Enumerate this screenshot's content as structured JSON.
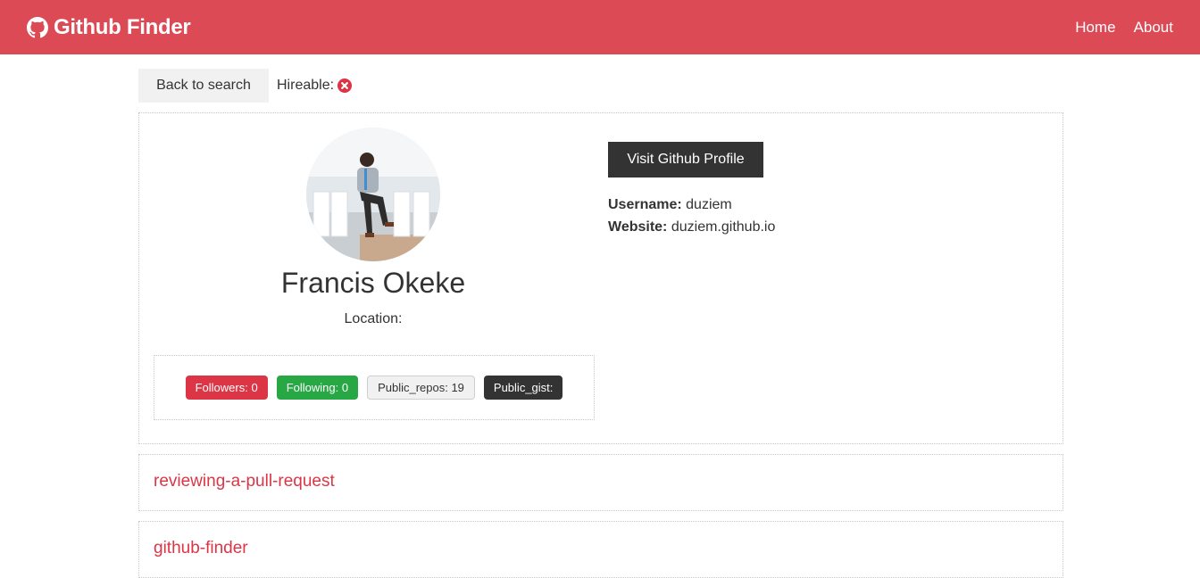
{
  "navbar": {
    "brand": "Github Finder",
    "brand_icon": "github-icon",
    "links": [
      "Home",
      "About"
    ],
    "bg_color": "#dc4a56"
  },
  "actions": {
    "back_label": "Back to search",
    "hireable_label": "Hireable:",
    "hireable_icon": "times-circle-icon"
  },
  "profile": {
    "name": "Francis Okeke",
    "location_label": "Location:",
    "visit_label": "Visit Github Profile",
    "username_label": "Username:",
    "username": "duziem",
    "website_label": "Website:",
    "website": "duziem.github.io"
  },
  "badges": {
    "followers": "Followers: 0",
    "following": "Following: 0",
    "public_repos": "Public_repos: 19",
    "public_gist": "Public_gist:"
  },
  "repos": [
    "reviewing-a-pull-request",
    "github-finder"
  ],
  "colors": {
    "accent": "#dc3545",
    "success": "#28a745",
    "dark": "#333333",
    "light": "#f1f1f1"
  }
}
